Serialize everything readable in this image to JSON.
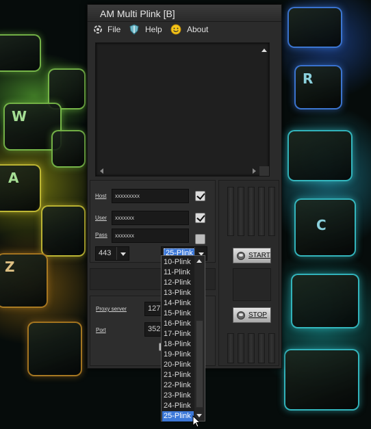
{
  "window": {
    "title": "AM Multi Plink [B]"
  },
  "menu": {
    "file": "File",
    "help": "Help",
    "about": "About"
  },
  "wallpaper": {
    "keys": [
      "W",
      "A",
      "R",
      "C",
      "Z"
    ]
  },
  "form": {
    "host_label": "Host",
    "host_value": "xxxxxxxxx",
    "host_checked": true,
    "user_label": "User",
    "user_value": "xxxxxxx",
    "user_checked": true,
    "pass_label": "Pass",
    "pass_value": "xxxxxxx",
    "pass_checked": false,
    "port_combo_value": "443",
    "plink_combo_value": "25-Plink",
    "proxy_server_label": "Proxy server",
    "proxy_server_value": "127.",
    "port_label": "Port",
    "port_value": "3523"
  },
  "buttons": {
    "start": "START",
    "stop": "STOP"
  },
  "dropdown": {
    "items": [
      "10-Plink",
      "11-Plink",
      "12-Plink",
      "13-Plink",
      "14-Plink",
      "15-Plink",
      "16-Plink",
      "17-Plink",
      "18-Plink",
      "19-Plink",
      "20-Plink",
      "21-Plink",
      "22-Plink",
      "23-Plink",
      "24-Plink",
      "25-Plink"
    ],
    "selected": "25-Plink"
  },
  "colors": {
    "selection": "#3c78d8",
    "window_bg": "#2b2b2b",
    "field_bg": "#1a1a1a"
  }
}
